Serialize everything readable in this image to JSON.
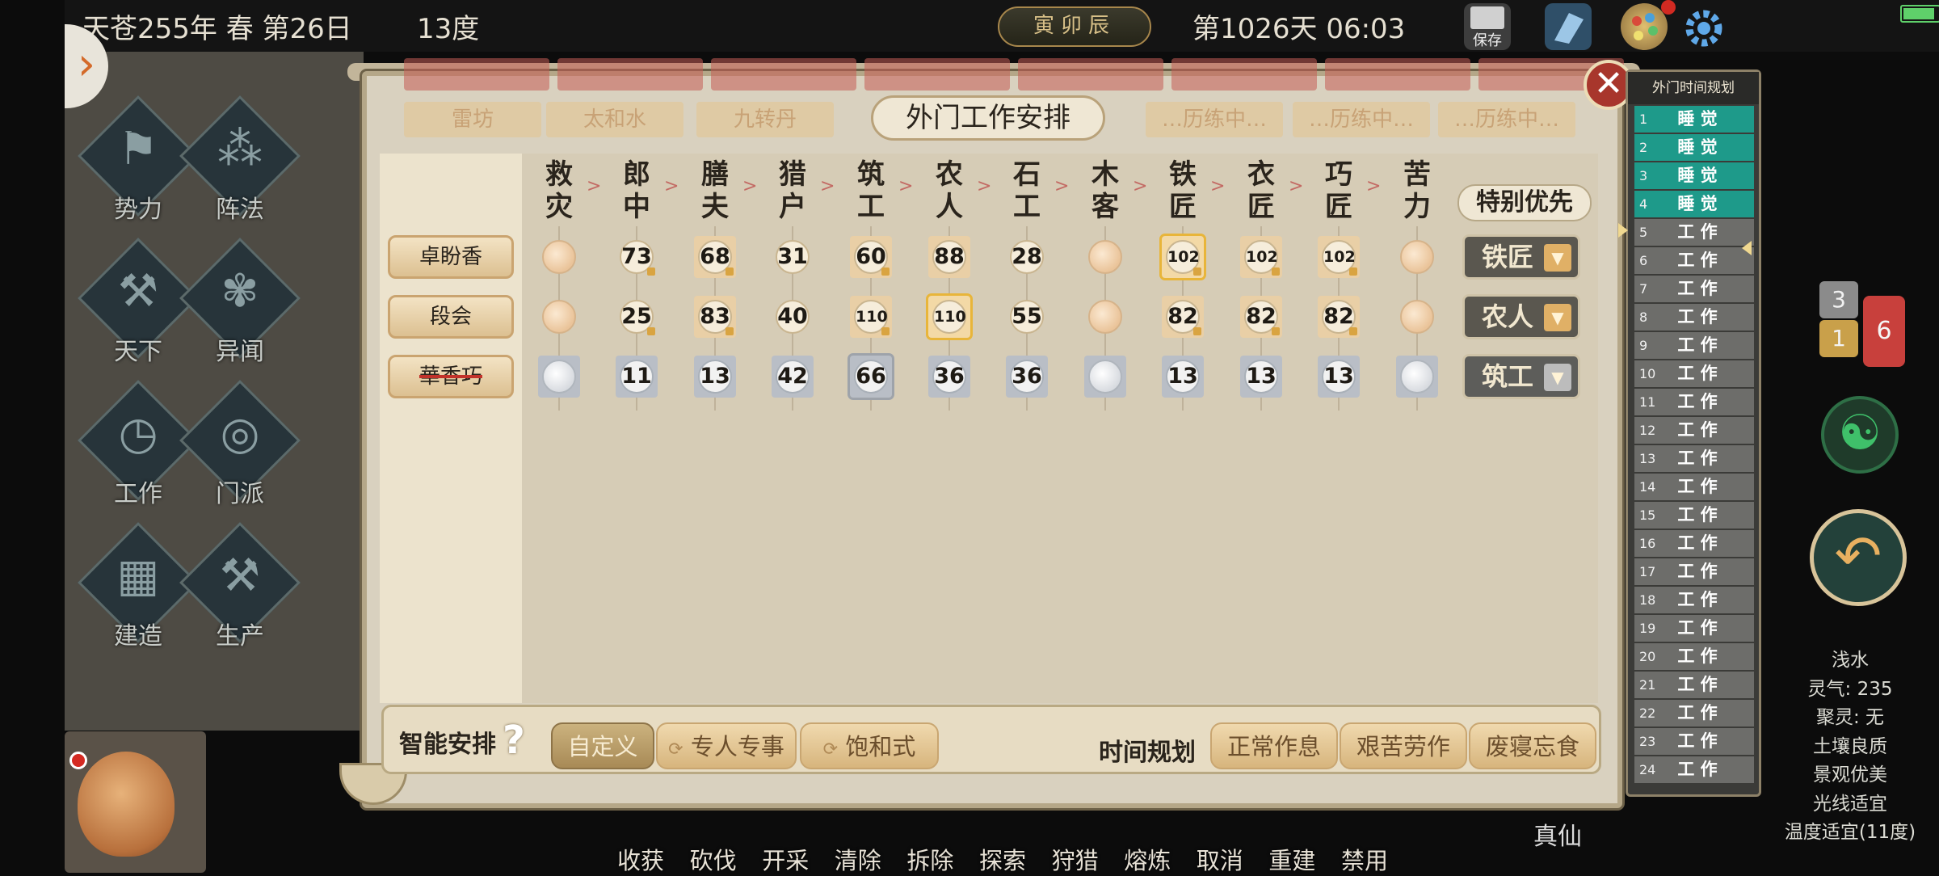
{
  "status_bar": {
    "date_text": "天苍255年 春 第26日",
    "temperature": "13度",
    "ganzhi": "寅卯辰",
    "day_time": "第1026天 06:03",
    "save_label": "保存",
    "battery_level": 0.9
  },
  "left_menu": {
    "items": [
      {
        "label": "势力",
        "icon": "banner-icon"
      },
      {
        "label": "阵法",
        "icon": "formation-icon"
      },
      {
        "label": "天下",
        "icon": "world-icon"
      },
      {
        "label": "异闻",
        "icon": "butterfly-icon"
      },
      {
        "label": "工作",
        "icon": "clock-icon"
      },
      {
        "label": "门派",
        "icon": "sect-icon"
      },
      {
        "label": "建造",
        "icon": "build-icon"
      },
      {
        "label": "生产",
        "icon": "produce-icon"
      }
    ]
  },
  "bottom_actions": [
    "收获",
    "砍伐",
    "开采",
    "清除",
    "拆除",
    "探索",
    "狩猎",
    "熔炼",
    "取消",
    "重建",
    "禁用"
  ],
  "realm_label": "真仙",
  "panel": {
    "title": "外门工作安排",
    "background_tabs": [
      "雷坊",
      "太和水",
      "九转丹",
      "…历练中…",
      "…历练中…",
      "…历练中…"
    ],
    "jobs": [
      {
        "name": "救灾",
        "c1": "救",
        "c2": "灾"
      },
      {
        "name": "郎中",
        "c1": "郎",
        "c2": "中"
      },
      {
        "name": "膳夫",
        "c1": "膳",
        "c2": "夫"
      },
      {
        "name": "猎户",
        "c1": "猎",
        "c2": "户"
      },
      {
        "name": "筑工",
        "c1": "筑",
        "c2": "工"
      },
      {
        "name": "农人",
        "c1": "农",
        "c2": "人"
      },
      {
        "name": "石工",
        "c1": "石",
        "c2": "工"
      },
      {
        "name": "木客",
        "c1": "木",
        "c2": "客"
      },
      {
        "name": "铁匠",
        "c1": "铁",
        "c2": "匠"
      },
      {
        "name": "衣匠",
        "c1": "衣",
        "c2": "匠"
      },
      {
        "name": "巧匠",
        "c1": "巧",
        "c2": "匠"
      },
      {
        "name": "苦力",
        "c1": "苦",
        "c2": "力"
      }
    ],
    "arrow": ">",
    "special_priority_label": "特别优先",
    "people": [
      {
        "name": "卓盼香",
        "disabled": false,
        "priority": "铁匠",
        "values": [
          "",
          "73",
          "68",
          "31",
          "60",
          "88",
          "28",
          "",
          "102",
          "102",
          "102",
          ""
        ],
        "highlight": 8
      },
      {
        "name": "段会",
        "disabled": false,
        "priority": "农人",
        "values": [
          "",
          "25",
          "83",
          "40",
          "110",
          "110",
          "55",
          "",
          "82",
          "82",
          "82",
          ""
        ],
        "highlight": 5
      },
      {
        "name": "華香巧",
        "disabled": true,
        "priority": "筑工",
        "values": [
          "",
          "11",
          "13",
          "42",
          "66",
          "36",
          "36",
          "",
          "13",
          "13",
          "13",
          ""
        ],
        "highlight": 4
      }
    ],
    "smart_label": "智能安排",
    "help_glyph": "?",
    "mode_buttons": [
      "自定义",
      "专人专事",
      "饱和式"
    ],
    "time_label": "时间规划",
    "time_buttons": [
      "正常作息",
      "艰苦劳作",
      "废寝忘食"
    ],
    "close_glyph": "✕"
  },
  "schedule": {
    "title": "外门时间规划",
    "hours": [
      {
        "h": "1",
        "a": "睡 觉"
      },
      {
        "h": "2",
        "a": "睡 觉"
      },
      {
        "h": "3",
        "a": "睡 觉"
      },
      {
        "h": "4",
        "a": "睡 觉"
      },
      {
        "h": "5",
        "a": "工 作"
      },
      {
        "h": "6",
        "a": "工 作"
      },
      {
        "h": "7",
        "a": "工 作"
      },
      {
        "h": "8",
        "a": "工 作"
      },
      {
        "h": "9",
        "a": "工 作"
      },
      {
        "h": "10",
        "a": "工 作"
      },
      {
        "h": "11",
        "a": "工 作"
      },
      {
        "h": "12",
        "a": "工 作"
      },
      {
        "h": "13",
        "a": "工 作"
      },
      {
        "h": "14",
        "a": "工 作"
      },
      {
        "h": "15",
        "a": "工 作"
      },
      {
        "h": "16",
        "a": "工 作"
      },
      {
        "h": "17",
        "a": "工 作"
      },
      {
        "h": "18",
        "a": "工 作"
      },
      {
        "h": "19",
        "a": "工 作"
      },
      {
        "h": "20",
        "a": "工 作"
      },
      {
        "h": "21",
        "a": "工 作"
      },
      {
        "h": "22",
        "a": "工 作"
      },
      {
        "h": "23",
        "a": "工 作"
      },
      {
        "h": "24",
        "a": "工 作"
      }
    ]
  },
  "side": {
    "bubble_gray": "3",
    "bubble_gold": "1",
    "bubble_red": "6",
    "env": [
      "浅水",
      "灵气: 235",
      "聚灵: 无",
      "土壤良质",
      "景观优美",
      "光线适宜",
      "温度适宜(11度)"
    ]
  },
  "colors": {
    "sleep": "#1e9a8a",
    "work": "#6d6d6a",
    "highlight": "#e8b53a",
    "close": "#a8362c"
  }
}
